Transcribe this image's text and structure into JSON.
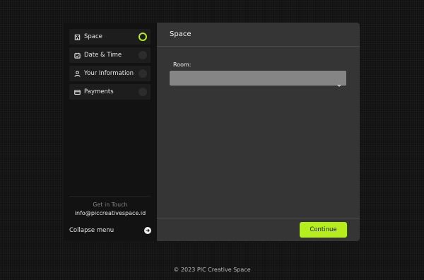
{
  "sidebar": {
    "steps": [
      {
        "label": "Space",
        "icon": "building-icon",
        "active": true
      },
      {
        "label": "Date & Time",
        "icon": "calendar-icon",
        "active": false
      },
      {
        "label": "Your Information",
        "icon": "user-icon",
        "active": false
      },
      {
        "label": "Payments",
        "icon": "card-icon",
        "active": false
      }
    ],
    "contact_title": "Get in Touch",
    "contact_email": "info@piccreativespace.id",
    "collapse_label": "Collapse menu"
  },
  "main": {
    "title": "Space",
    "room_label": "Room:",
    "room_value": "",
    "continue_label": "Continue"
  },
  "footer": {
    "copyright": "© 2023 PIC Creative Space"
  },
  "colors": {
    "accent": "#b6ee1d",
    "sidebar_bg": "#121212",
    "content_bg": "#353535"
  }
}
